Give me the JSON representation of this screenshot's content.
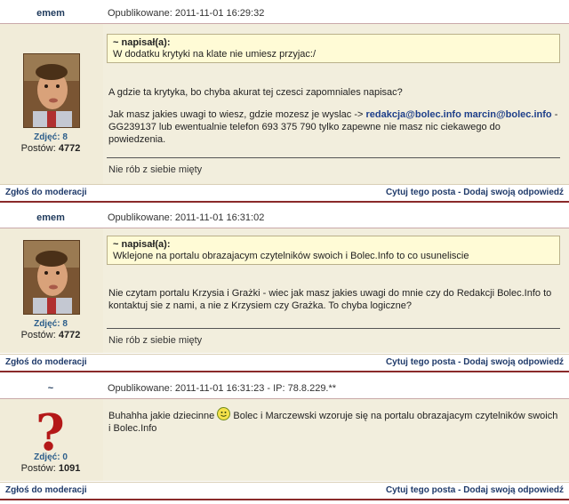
{
  "posts": [
    {
      "author": "emem",
      "date": "Opublikowane: 2011-11-01 16:29:32",
      "stat_label": "Zdjęć: 8",
      "posts_label": "Postów:",
      "posts_count": "4772",
      "quote_header": "~ napisał(a):",
      "quote_text": "W dodatku krytyki na klate nie umiesz przyjac:/",
      "text1": "A gdzie ta krytyka, bo chyba akurat tej czesci zapomniales napisac?",
      "text2_a": "Jak masz jakies uwagi to wiesz, gdzie mozesz je wyslac ->",
      "link1": "redakcja@bolec.info",
      "link2": "marcin@bolec.info",
      "text2_b": "- GG239137 lub ewentualnie telefon 693 375 790 tylko zapewne nie masz nic ciekawego do powiedzenia.",
      "signature": "Nie rób z siebie mięty",
      "report": "Zgłoś do moderacji",
      "quote_action": "Cytuj tego posta",
      "reply_action": "Dodaj swoją odpowiedź",
      "separator": "-"
    },
    {
      "author": "emem",
      "date": "Opublikowane: 2011-11-01 16:31:02",
      "stat_label": "Zdjęć: 8",
      "posts_label": "Postów:",
      "posts_count": "4772",
      "quote_header": "~ napisał(a):",
      "quote_text": "Wklejone na portalu obrazajacym czytelników swoich i Bolec.Info to co usuneliscie",
      "text1": "Nie czytam portalu Krzysia i Grażki - wiec jak masz jakies uwagi do mnie czy do Redakcji Bolec.Info to kontaktuj sie z nami, a nie z Krzysiem czy Grażka. To chyba logiczne?",
      "signature": "Nie rób z siebie mięty",
      "report": "Zgłoś do moderacji",
      "quote_action": "Cytuj tego posta",
      "reply_action": "Dodaj swoją odpowiedź",
      "separator": "-"
    },
    {
      "author": "~",
      "date": "Opublikowane: 2011-11-01 16:31:23 - IP: 78.8.229.**",
      "stat_label": "Zdjęć: 0",
      "posts_label": "Postów:",
      "posts_count": "1091",
      "avatar_glyph": "?",
      "text1_a": "Buhahha jakie dziecinne",
      "text1_b": "Bolec i Marczewski wzoruje się na portalu obrazajacym czytelników swoich i Bolec.Info",
      "report": "Zgłoś do moderacji",
      "quote_action": "Cytuj tego posta",
      "reply_action": "Dodaj swoją odpowiedź",
      "separator": "-"
    }
  ],
  "colors": {
    "author": "#1f3a5c",
    "link": "#1e3f8a",
    "stat": "#2b5d8a",
    "footer_border": "#8a2a2a",
    "quote_bg": "#fffbd6",
    "post_bg": "#f1ecd9"
  }
}
